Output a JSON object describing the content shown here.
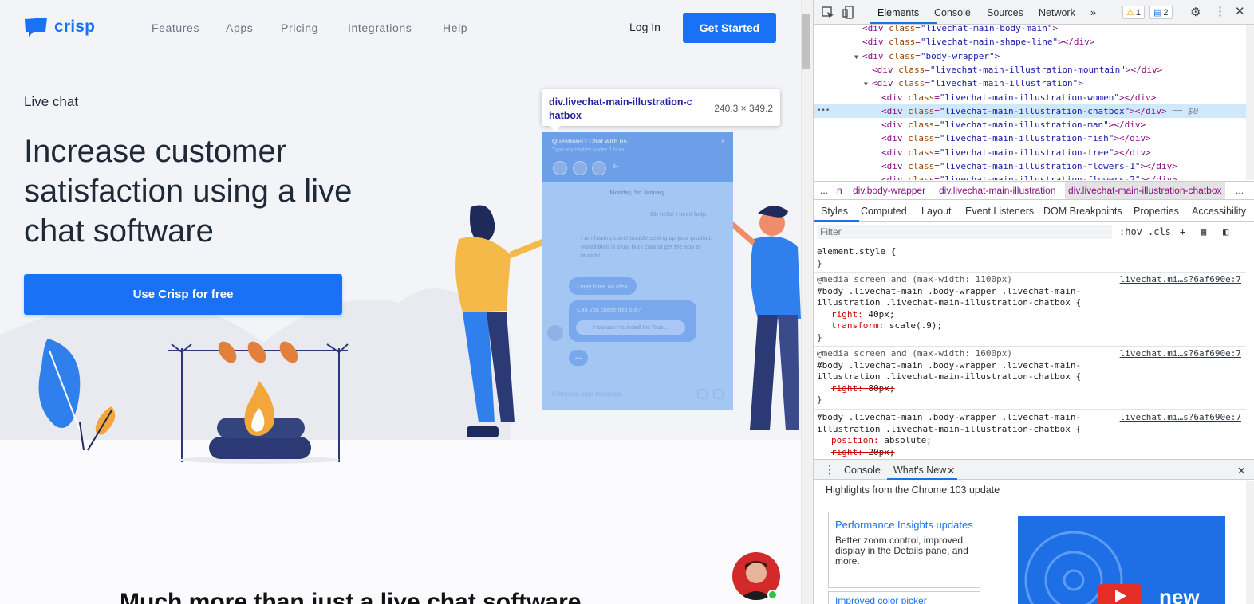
{
  "site": {
    "logo_text": "crisp",
    "nav": [
      "Features",
      "Apps",
      "Pricing",
      "Integrations",
      "Help"
    ],
    "login": "Log In",
    "get_started": "Get Started",
    "eyebrow": "Live chat",
    "headline": "Increase customer satisfaction using a live chat software",
    "cta": "Use Crisp for free",
    "bottom_title": "Much more than just a live chat software",
    "brand_color": "#1972f5"
  },
  "tooltip": {
    "element": "div.livechat-main-illustration-chatbox",
    "size": "240.3 × 349.2"
  },
  "chatbox": {
    "title": "Questions? Chat with us.",
    "subtitle": "Typically replies under 1 hour",
    "more": "3+",
    "close": "×",
    "date": "Monday, 1st January",
    "msg_user": "Oh hello! I need help.",
    "msg_long": "I am having some trouble setting up your product. Installation is okay but I cannot get the app to launch!",
    "bubble_idea": "I may have an idea.",
    "bubble_check": "Can you check this out?",
    "bubble_link": "How can I re-install the Trub...",
    "typing": "•••",
    "compose": "Compose your message..."
  },
  "devtools": {
    "tabs": [
      "Elements",
      "Console",
      "Sources",
      "Network",
      "»"
    ],
    "warnings": "1",
    "messages": "2",
    "dom_lines": [
      {
        "indent": 5,
        "toggle": "",
        "tag": "div",
        "cls": "livechat-main-body-main",
        "close": "",
        "sel": false,
        "partial": true
      },
      {
        "indent": 5,
        "toggle": "",
        "tag": "div",
        "cls": "livechat-main-shape-line",
        "close": "</div>",
        "sel": false
      },
      {
        "indent": 5,
        "toggle": "▼",
        "tag": "div",
        "cls": "body-wrapper",
        "close": "",
        "sel": false
      },
      {
        "indent": 6,
        "toggle": "",
        "tag": "div",
        "cls": "livechat-main-illustration-mountain",
        "close": "</div>",
        "sel": false
      },
      {
        "indent": 6,
        "toggle": "▼",
        "tag": "div",
        "cls": "livechat-main-illustration",
        "close": "",
        "sel": false
      },
      {
        "indent": 7,
        "toggle": "",
        "tag": "div",
        "cls": "livechat-main-illustration-women",
        "close": "</div>",
        "sel": false
      },
      {
        "indent": 7,
        "toggle": "",
        "tag": "div",
        "cls": "livechat-main-illustration-chatbox",
        "close": "</div>",
        "sel": true
      },
      {
        "indent": 7,
        "toggle": "",
        "tag": "div",
        "cls": "livechat-main-illustration-man",
        "close": "</div>",
        "sel": false
      },
      {
        "indent": 7,
        "toggle": "",
        "tag": "div",
        "cls": "livechat-main-illustration-fish",
        "close": "</div>",
        "sel": false
      },
      {
        "indent": 7,
        "toggle": "",
        "tag": "div",
        "cls": "livechat-main-illustration-tree",
        "close": "</div>",
        "sel": false
      },
      {
        "indent": 7,
        "toggle": "",
        "tag": "div",
        "cls": "livechat-main-illustration-flowers-1",
        "close": "</div>",
        "sel": false
      },
      {
        "indent": 7,
        "toggle": "",
        "tag": "div",
        "cls": "livechat-main-illustration-flowers-2",
        "close": "</div>",
        "sel": false
      }
    ],
    "selected_marker": "== $0",
    "breadcrumbs": [
      "...",
      "n",
      "div.body-wrapper",
      "div.livechat-main-illustration",
      "div.livechat-main-illustration-chatbox",
      "..."
    ],
    "sub_tabs": [
      "Styles",
      "Computed",
      "Layout",
      "Event Listeners",
      "DOM Breakpoints",
      "Properties",
      "Accessibility"
    ],
    "filter_placeholder": "Filter",
    "hov": ":hov",
    "cls": ".cls",
    "rules": [
      {
        "media": "",
        "selector": "element.style {",
        "source": "",
        "props": []
      },
      {
        "media": "@media screen and (max-width: 1100px)",
        "selector": "#body .livechat-main .body-wrapper .livechat-main-illustration .livechat-main-illustration-chatbox {",
        "source": "livechat.mi…s?6af690e:7",
        "props": [
          {
            "name": "right",
            "value": "40px;",
            "struck": false
          },
          {
            "name": "transform",
            "value": "scale(.9);",
            "struck": false
          }
        ]
      },
      {
        "media": "@media screen and (max-width: 1600px)",
        "selector": "#body .livechat-main .body-wrapper .livechat-main-illustration .livechat-main-illustration-chatbox {",
        "source": "livechat.mi…s?6af690e:7",
        "props": [
          {
            "name": "right",
            "value": "80px;",
            "struck": true
          }
        ]
      },
      {
        "media": "",
        "selector": "#body .livechat-main .body-wrapper .livechat-main-illustration .livechat-main-illustration-chatbox {",
        "source": "livechat.mi…s?6af690e:7",
        "props": [
          {
            "name": "position",
            "value": "absolute;",
            "struck": false
          },
          {
            "name": "right",
            "value": "20px;",
            "struck": true
          }
        ]
      }
    ],
    "drawer_tabs": [
      "Console",
      "What's New"
    ],
    "whats_new_header": "Highlights from the Chrome 103 update",
    "card1_title": "Performance Insights updates",
    "card1_body": "Better zoom control, improved display in the Details pane, and more.",
    "card2_title": "Improved color picker",
    "promo_text": "new"
  }
}
